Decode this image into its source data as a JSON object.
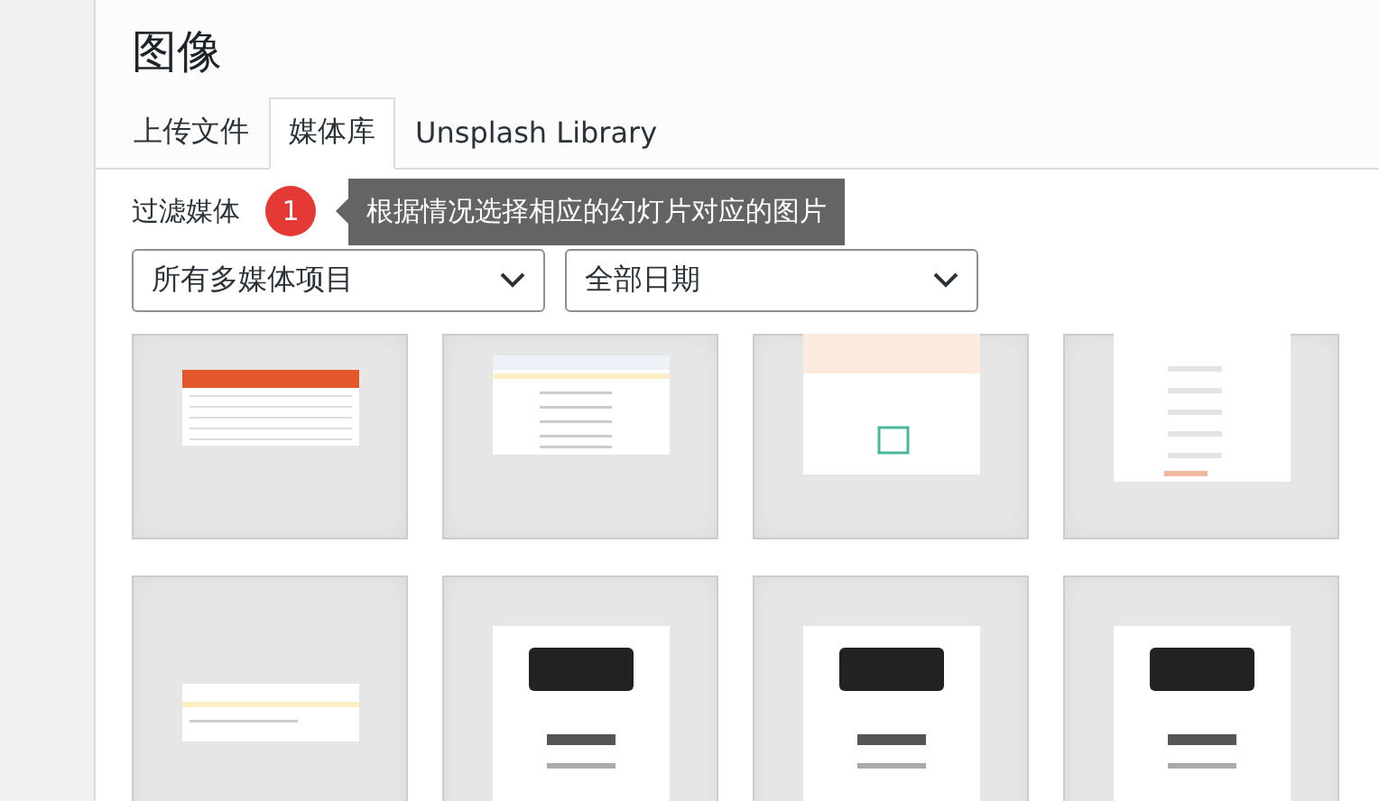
{
  "title": "图像",
  "tabs": [
    {
      "label": "上传文件",
      "selected": false
    },
    {
      "label": "媒体库",
      "selected": true
    },
    {
      "label": "Unsplash Library",
      "selected": false
    }
  ],
  "filter": {
    "label": "过滤媒体",
    "type_select": "所有多媒体项目",
    "date_select": "全部日期"
  },
  "callout": {
    "badge": "1",
    "tooltip": "根据情况选择相应的幻灯片对应的图片"
  },
  "media_items": [
    {
      "kind": "table"
    },
    {
      "kind": "document"
    },
    {
      "kind": "webpage"
    },
    {
      "kind": "form"
    },
    {
      "kind": "strip"
    },
    {
      "kind": "card"
    },
    {
      "kind": "card"
    },
    {
      "kind": "card"
    }
  ]
}
